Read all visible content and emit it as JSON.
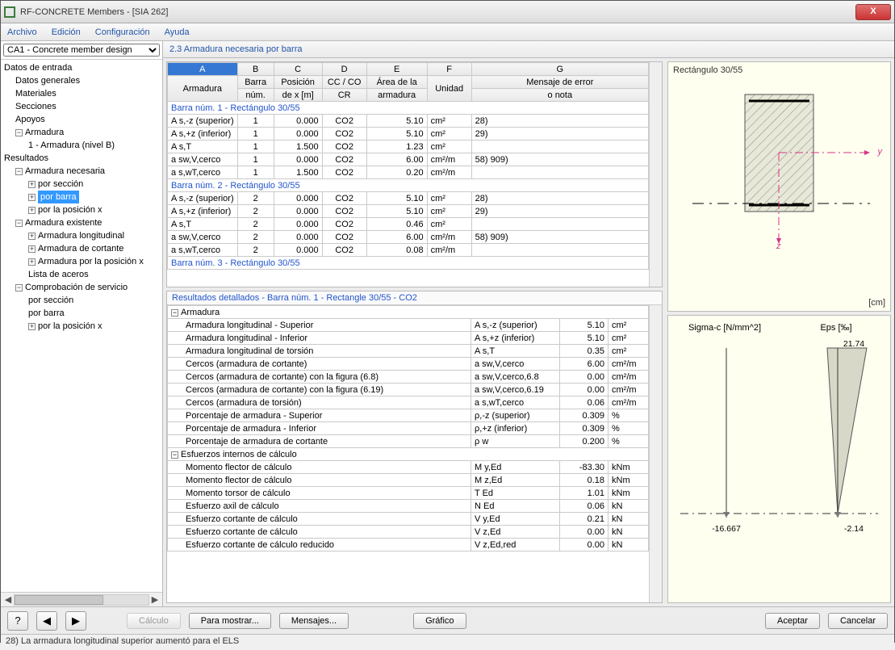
{
  "window": {
    "title": "RF-CONCRETE Members - [SIA 262]"
  },
  "menu": {
    "file": "Archivo",
    "edit": "Edición",
    "config": "Configuración",
    "help": "Ayuda"
  },
  "sidebar": {
    "case": "CA1 - Concrete member design",
    "tree": {
      "input": "Datos de entrada",
      "general": "Datos generales",
      "materials": "Materiales",
      "sections": "Secciones",
      "supports": "Apoyos",
      "reinf": "Armadura",
      "reinf1": "1 - Armadura (nivel B)",
      "results": "Resultados",
      "req_reinf": "Armadura necesaria",
      "by_section": "por sección",
      "by_bar": "por barra",
      "by_xpos": "por la posición x",
      "exist_reinf": "Armadura existente",
      "long_reinf": "Armadura longitudinal",
      "shear_reinf": "Armadura de cortante",
      "reinf_by_x": "Armadura por la posición x",
      "steel_list": "Lista de aceros",
      "serv_check": "Comprobación de servicio",
      "sc_section": "por sección",
      "sc_bar": "por barra",
      "sc_xpos": "por la posición x"
    }
  },
  "content": {
    "title": "2.3 Armadura necesaria por barra",
    "cols": {
      "A": "A",
      "B": "B",
      "C": "C",
      "D": "D",
      "E": "E",
      "F": "F",
      "G": "G",
      "h1": "Armadura",
      "h2a": "Barra",
      "h2b": "núm.",
      "h3a": "Posición",
      "h3b": "de x [m]",
      "h4a": "CC / CO",
      "h4b": "CR",
      "h5a": "Área de la",
      "h5b": "armadura",
      "h6": "Unidad",
      "h7a": "Mensaje de error",
      "h7b": "o nota"
    },
    "sec1": "Barra núm. 1  -  Rectángulo 30/55",
    "sec2": "Barra núm. 2  -  Rectángulo 30/55",
    "sec3": "Barra núm. 3  -  Rectángulo 30/55",
    "rows1": [
      {
        "a": "A s,-z (superior)",
        "b": "1",
        "c": "0.000",
        "d": "CO2",
        "e": "5.10",
        "f": "cm²",
        "g": "28)"
      },
      {
        "a": "A s,+z (inferior)",
        "b": "1",
        "c": "0.000",
        "d": "CO2",
        "e": "5.10",
        "f": "cm²",
        "g": "29)"
      },
      {
        "a": "A s,T",
        "b": "1",
        "c": "1.500",
        "d": "CO2",
        "e": "1.23",
        "f": "cm²",
        "g": ""
      },
      {
        "a": "a sw,V,cerco",
        "b": "1",
        "c": "0.000",
        "d": "CO2",
        "e": "6.00",
        "f": "cm²/m",
        "g": "58) 909)"
      },
      {
        "a": "a s,wT,cerco",
        "b": "1",
        "c": "1.500",
        "d": "CO2",
        "e": "0.20",
        "f": "cm²/m",
        "g": ""
      }
    ],
    "rows2": [
      {
        "a": "A s,-z (superior)",
        "b": "2",
        "c": "0.000",
        "d": "CO2",
        "e": "5.10",
        "f": "cm²",
        "g": "28)"
      },
      {
        "a": "A s,+z (inferior)",
        "b": "2",
        "c": "0.000",
        "d": "CO2",
        "e": "5.10",
        "f": "cm²",
        "g": "29)"
      },
      {
        "a": "A s,T",
        "b": "2",
        "c": "0.000",
        "d": "CO2",
        "e": "0.46",
        "f": "cm²",
        "g": ""
      },
      {
        "a": "a sw,V,cerco",
        "b": "2",
        "c": "0.000",
        "d": "CO2",
        "e": "6.00",
        "f": "cm²/m",
        "g": "58) 909)"
      },
      {
        "a": "a s,wT,cerco",
        "b": "2",
        "c": "0.000",
        "d": "CO2",
        "e": "0.08",
        "f": "cm²/m",
        "g": ""
      }
    ]
  },
  "details": {
    "header": "Resultados detallados  -  Barra núm. 1  -  Rectangle 30/55  -  CO2",
    "g1": "Armadura",
    "g2": "Esfuerzos internos de cálculo",
    "r": [
      {
        "i": 1,
        "l": "Armadura longitudinal - Superior",
        "s": "A s,-z (superior)",
        "v": "5.10",
        "u": "cm²"
      },
      {
        "i": 1,
        "l": "Armadura longitudinal - Inferior",
        "s": "A s,+z (inferior)",
        "v": "5.10",
        "u": "cm²"
      },
      {
        "i": 1,
        "l": "Armadura longitudinal de torsión",
        "s": "A s,T",
        "v": "0.35",
        "u": "cm²"
      },
      {
        "i": 1,
        "l": "Cercos (armadura de cortante)",
        "s": "a sw,V,cerco",
        "v": "6.00",
        "u": "cm²/m"
      },
      {
        "i": 1,
        "l": "Cercos (armadura de cortante) con la figura (6.8)",
        "s": "a sw,V,cerco,6.8",
        "v": "0.00",
        "u": "cm²/m"
      },
      {
        "i": 1,
        "l": "Cercos (armadura de cortante) con la figura (6.19)",
        "s": "a sw,V,cerco,6.19",
        "v": "0.00",
        "u": "cm²/m"
      },
      {
        "i": 1,
        "l": "Cercos (armadura de torsión)",
        "s": "a s,wT,cerco",
        "v": "0.06",
        "u": "cm²/m"
      },
      {
        "i": 1,
        "l": "Porcentaje de armadura - Superior",
        "s": "ρ,-z (superior)",
        "v": "0.309",
        "u": "%"
      },
      {
        "i": 1,
        "l": "Porcentaje de armadura - Inferior",
        "s": "ρ,+z (inferior)",
        "v": "0.309",
        "u": "%"
      },
      {
        "i": 1,
        "l": "Porcentaje de armadura de cortante",
        "s": "ρ w",
        "v": "0.200",
        "u": "%"
      },
      {
        "i": 2,
        "l": "Momento flector de cálculo",
        "s": "M y,Ed",
        "v": "-83.30",
        "u": "kNm"
      },
      {
        "i": 2,
        "l": "Momento flector de cálculo",
        "s": "M z,Ed",
        "v": "0.18",
        "u": "kNm"
      },
      {
        "i": 2,
        "l": "Momento torsor de cálculo",
        "s": "T Ed",
        "v": "1.01",
        "u": "kNm"
      },
      {
        "i": 2,
        "l": "Esfuerzo axil de cálculo",
        "s": "N Ed",
        "v": "0.06",
        "u": "kN"
      },
      {
        "i": 2,
        "l": "Esfuerzo cortante de cálculo",
        "s": "V y,Ed",
        "v": "0.21",
        "u": "kN"
      },
      {
        "i": 2,
        "l": "Esfuerzo cortante de cálculo",
        "s": "V z,Ed",
        "v": "0.00",
        "u": "kN"
      },
      {
        "i": 2,
        "l": "Esfuerzo cortante de cálculo reducido",
        "s": "V z,Ed,red",
        "v": "0.00",
        "u": "kN"
      }
    ]
  },
  "cross": {
    "title": "Rectángulo 30/55",
    "unit": "[cm]",
    "y": "y",
    "z": "z"
  },
  "diag": {
    "sigma": "Sigma-c [N/mm^2]",
    "eps": "Eps [‰]",
    "v1": "-16.667",
    "v2": "-2.14",
    "v3": "21.74"
  },
  "buttons": {
    "calc": "Cálculo",
    "show": "Para mostrar...",
    "msgs": "Mensajes...",
    "graph": "Gráfico",
    "ok": "Aceptar",
    "cancel": "Cancelar"
  },
  "status": "28) La armadura longitudinal superior aumentó para el ELS"
}
